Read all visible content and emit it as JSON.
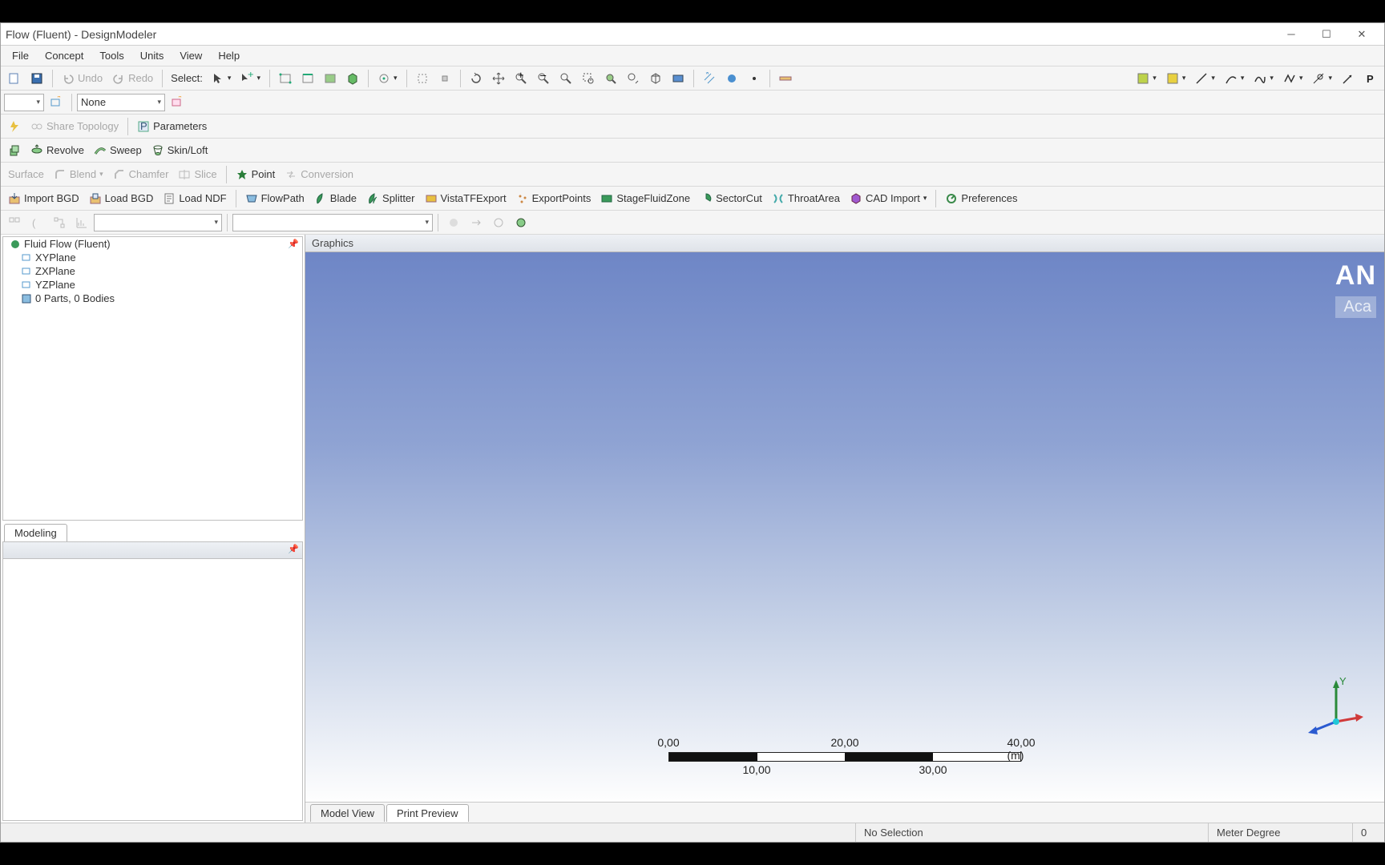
{
  "window": {
    "title": "Flow (Fluent) - DesignModeler"
  },
  "menus": [
    "File",
    "Concept",
    "Tools",
    "Units",
    "View",
    "Help"
  ],
  "tb1": {
    "undo": "Undo",
    "redo": "Redo",
    "select": "Select:"
  },
  "tb2": {
    "filter": "None"
  },
  "tb3": {
    "share": "Share Topology",
    "params": "Parameters"
  },
  "tb4": {
    "revolve": "Revolve",
    "sweep": "Sweep",
    "skin": "Skin/Loft"
  },
  "tb5": {
    "surface": "Surface",
    "blend": "Blend",
    "chamfer": "Chamfer",
    "slice": "Slice",
    "point": "Point",
    "conversion": "Conversion"
  },
  "tb6": {
    "importbgd": "Import BGD",
    "loadbgd": "Load BGD",
    "loadndf": "Load NDF",
    "flowpath": "FlowPath",
    "blade": "Blade",
    "splitter": "Splitter",
    "vista": "VistaTFExport",
    "exportpts": "ExportPoints",
    "stagefluid": "StageFluidZone",
    "sectorcut": "SectorCut",
    "throat": "ThroatArea",
    "cadimport": "CAD Import",
    "prefs": "Preferences"
  },
  "tree": {
    "root": "Fluid Flow (Fluent)",
    "items": [
      "XYPlane",
      "ZXPlane",
      "YZPlane",
      "0 Parts, 0 Bodies"
    ]
  },
  "left_tabs": {
    "modeling": "Modeling"
  },
  "gfx": {
    "title": "Graphics",
    "brand1": "AN",
    "brand2": "Aca",
    "ruler": {
      "t0": "0,00",
      "t10": "10,00",
      "t20": "20,00",
      "t30": "30,00",
      "t40": "40,00 (m)"
    },
    "tab_model": "Model View",
    "tab_print": "Print Preview"
  },
  "status": {
    "sel": "No Selection",
    "units": "Meter  Degree",
    "zero": "0"
  }
}
